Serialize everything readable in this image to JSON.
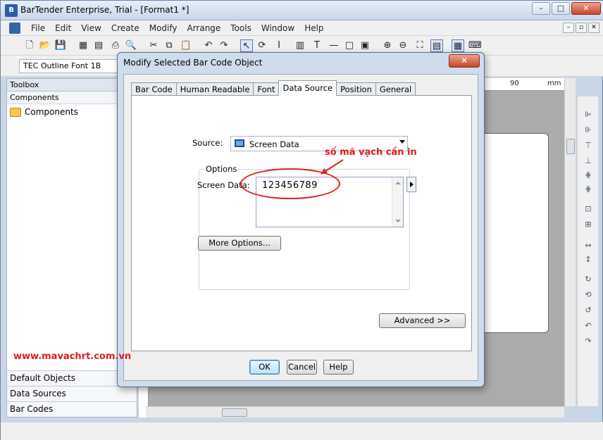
{
  "app": {
    "title": "BarTender Enterprise, Trial - [Format1 *]",
    "window_buttons": [
      "–",
      "□",
      "✕"
    ],
    "mdi_buttons": [
      "–",
      "▫",
      "✕"
    ]
  },
  "menu": [
    "File",
    "Edit",
    "View",
    "Create",
    "Modify",
    "Arrange",
    "Tools",
    "Window",
    "Help"
  ],
  "toolbar": {
    "icons": [
      "new-icon",
      "open-icon",
      "save-icon",
      "print-icon",
      "cut-icon",
      "copy-icon",
      "paste-icon",
      "undo-icon",
      "redo-icon",
      "select-icon",
      "rotate-icon",
      "text-icon",
      "barcode-icon",
      "line-icon",
      "box-icon",
      "picture-icon",
      "zoom-in-icon",
      "zoom-out-icon",
      "fit-icon"
    ],
    "font_select": "TEC Outline Font 1B"
  },
  "toolbox": {
    "header": "Toolbox",
    "sub": "Components",
    "item": "Components",
    "bottom": [
      "Default Objects",
      "Data Sources",
      "Bar Codes"
    ]
  },
  "ruler": {
    "label_90": "90",
    "unit": "mm"
  },
  "dialog": {
    "title": "Modify Selected Bar Code Object",
    "close": "✕",
    "tabs": [
      "Bar Code",
      "Human Readable",
      "Font",
      "Data Source",
      "Position",
      "General"
    ],
    "active_tab": "Data Source",
    "source_label": "Source:",
    "source_value": "Screen Data",
    "options_label": "Options",
    "screen_data_label": "Screen Data:",
    "screen_data_value": "123456789",
    "more_options": "More Options...",
    "advanced": "Advanced >>",
    "ok": "OK",
    "cancel": "Cancel",
    "help": "Help"
  },
  "annotation": {
    "text": "số mã vạch cần in",
    "watermark": "www.mavachrt.com.vn",
    "color": "#e11d1d"
  }
}
